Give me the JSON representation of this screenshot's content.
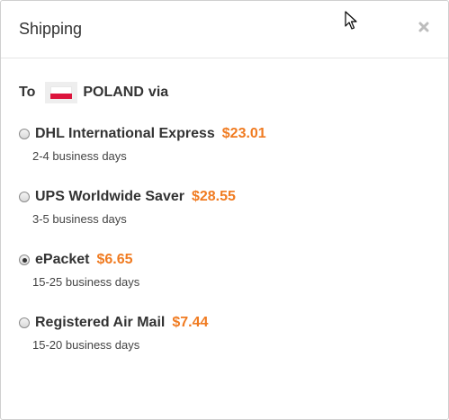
{
  "dialog": {
    "title": "Shipping",
    "close_symbol": "×"
  },
  "destination": {
    "prefix": "To",
    "flag_icon": "poland-flag-icon",
    "country": "POLAND",
    "suffix": "via"
  },
  "shipping_options": [
    {
      "carrier": "DHL International Express",
      "price": "$23.01",
      "days": "2-4 business days",
      "selected": false
    },
    {
      "carrier": "UPS Worldwide Saver",
      "price": "$28.55",
      "days": "3-5 business days",
      "selected": false
    },
    {
      "carrier": "ePacket",
      "price": "$6.65",
      "days": "15-25 business days",
      "selected": true
    },
    {
      "carrier": "Registered Air Mail",
      "price": "$7.44",
      "days": "15-20 business days",
      "selected": false
    }
  ],
  "colors": {
    "price": "#f07b21",
    "text": "#333333",
    "flag_red": "#dc143c"
  }
}
